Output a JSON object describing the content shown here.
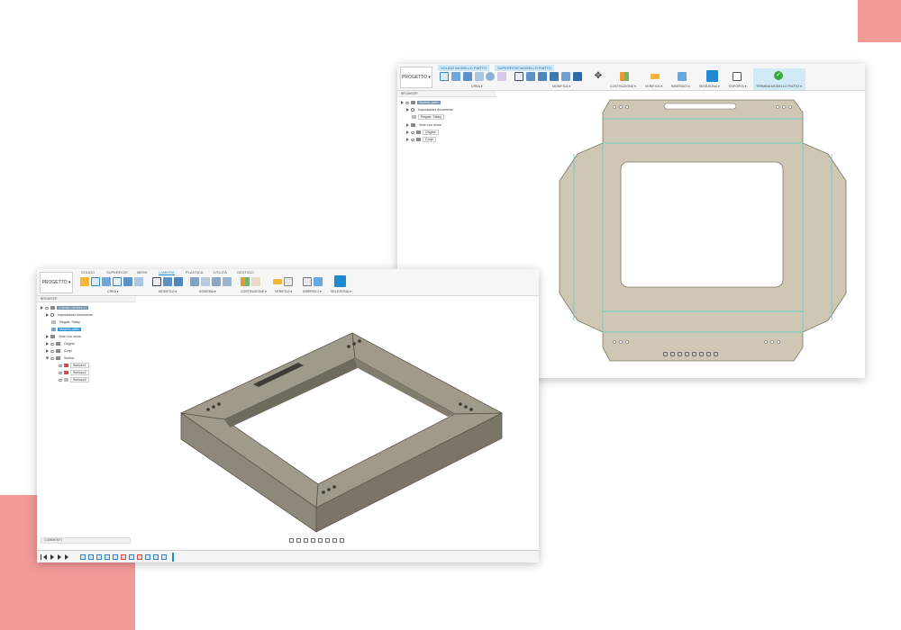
{
  "colors": {
    "decor": "#f29a98",
    "accent": "#1f8ad2",
    "part": "#cfc6b4",
    "body": "#8b8474"
  },
  "front": {
    "project_label": "PROGETTO ▾",
    "tabs": [
      "SOLIDO",
      "SUPERFICIE",
      "MESH",
      "LAMIERA",
      "PLASTICA",
      "UTILITÀ",
      "GESTISCI"
    ],
    "active_tab": "LAMIERA",
    "groups": [
      "CREA ▾",
      "MODIFICA ▾",
      "ASSIEMA ▾",
      "COSTRUZIONE ▾",
      "VERIFICA ▾",
      "INSERISCI ▾",
      "SELEZIONA ▾"
    ],
    "browser_title": "BROWSER",
    "browser_items": [
      {
        "label": "Cornice Lamiera v1",
        "style": "root"
      },
      {
        "label": "Impostazioni documento",
        "style": "plain"
      },
      {
        "label": "Regole: Sticky",
        "style": "plain"
      },
      {
        "label": "Modello piatto",
        "style": "sel"
      },
      {
        "label": "Viste con nome",
        "style": "plain"
      },
      {
        "label": "Origine",
        "style": "plain"
      },
      {
        "label": "Corpi",
        "style": "plain"
      },
      {
        "label": "Schizzi",
        "style": "plain"
      },
      {
        "label": "Schizzo1",
        "style": "box"
      },
      {
        "label": "Schizzo2",
        "style": "box"
      },
      {
        "label": "Schizzo3",
        "style": "box"
      }
    ],
    "comments_label": "COMMENTI"
  },
  "back": {
    "project_label": "PROGETTO ▾",
    "tabs": [
      "SOLIDO MODELLO PIATTO",
      "SUPERFICIE MODELLO PIATTO"
    ],
    "groups": [
      "CREA ▾",
      "MODIFICA ▾",
      "COSTRUZIONE ▾",
      "VERIFICA ▾",
      "INSERISCI ▾",
      "SELEZIONA ▾",
      "ESPORTA ▾",
      "TERMINA MODELLO PIATTO ▾"
    ],
    "browser_title": "BROWSER",
    "browser_items": [
      {
        "label": "Modello piatto",
        "style": "root"
      },
      {
        "label": "Impostazioni documento",
        "style": "plain"
      },
      {
        "label": "Regole: Sticky",
        "style": "box"
      },
      {
        "label": "Viste con nome",
        "style": "plain"
      },
      {
        "label": "Origine",
        "style": "plain"
      },
      {
        "label": "Corpi",
        "style": "plain"
      }
    ]
  }
}
